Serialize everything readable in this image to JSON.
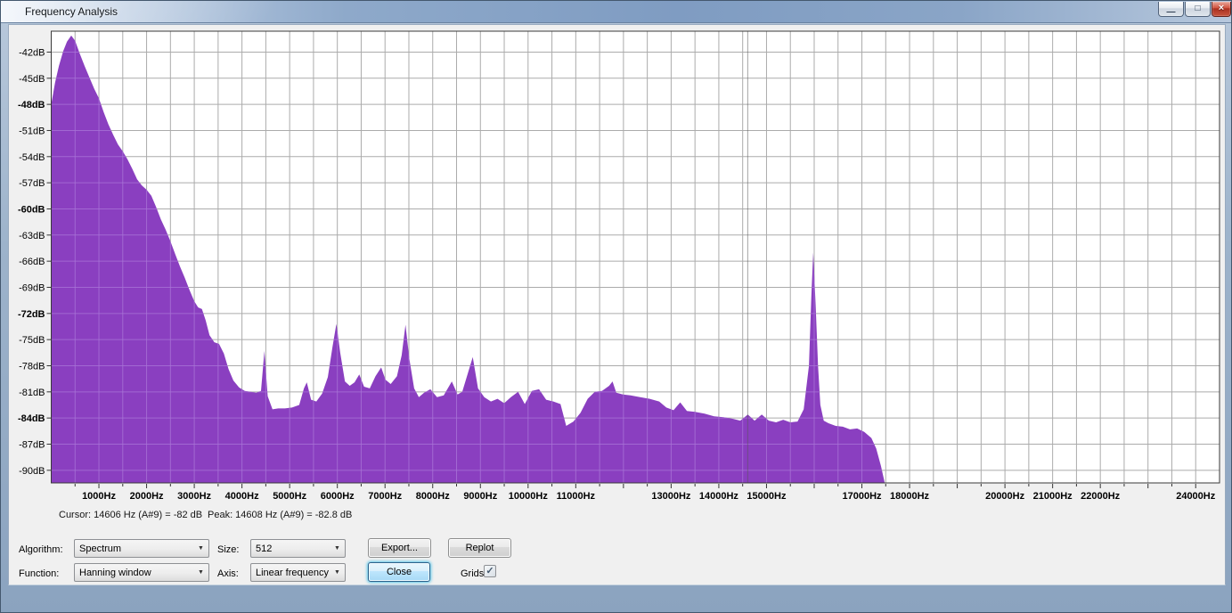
{
  "window": {
    "title": "Frequency Analysis"
  },
  "icons": {
    "minimize": "—",
    "maximize": "□",
    "close": "×",
    "combo_arrow": "▼",
    "check": "✓"
  },
  "status": {
    "cursor": "Cursor: 14606 Hz (A#9) = -82 dB",
    "peak": "Peak: 14608 Hz (A#9) = -82.8 dB"
  },
  "controls": {
    "algorithm_label": "Algorithm:",
    "algorithm_value": "Spectrum",
    "size_label": "Size:",
    "size_value": "512",
    "function_label": "Function:",
    "function_value": "Hanning window",
    "axis_label": "Axis:",
    "axis_value": "Linear frequency",
    "export_label": "Export...",
    "replot_label": "Replot",
    "close_label": "Close",
    "grids_label": "Grids",
    "grids_checked": true
  },
  "chart_data": {
    "type": "area",
    "series_name": "Spectrum (Hanning window, size 512)",
    "xlim": [
      0,
      24500
    ],
    "ylim": [
      -91.45,
      -39.6
    ],
    "grid": true,
    "grid_spacing_hz": 500,
    "grid_spacing_db": 3,
    "cursor_hz": 14606,
    "x_labels": [
      {
        "f": 1000,
        "label": "1000Hz"
      },
      {
        "f": 2000,
        "label": "2000Hz"
      },
      {
        "f": 3000,
        "label": "3000Hz"
      },
      {
        "f": 4000,
        "label": "4000Hz"
      },
      {
        "f": 5000,
        "label": "5000Hz"
      },
      {
        "f": 6000,
        "label": "6000Hz"
      },
      {
        "f": 7000,
        "label": "7000Hz"
      },
      {
        "f": 8000,
        "label": "8000Hz"
      },
      {
        "f": 9000,
        "label": "9000Hz"
      },
      {
        "f": 10000,
        "label": "10000Hz"
      },
      {
        "f": 11000,
        "label": "11000Hz"
      },
      {
        "f": 13000,
        "label": "13000Hz"
      },
      {
        "f": 14000,
        "label": "14000Hz"
      },
      {
        "f": 15000,
        "label": "15000Hz"
      },
      {
        "f": 17000,
        "label": "17000Hz"
      },
      {
        "f": 18000,
        "label": "18000Hz"
      },
      {
        "f": 20000,
        "label": "20000Hz"
      },
      {
        "f": 21000,
        "label": "21000Hz"
      },
      {
        "f": 22000,
        "label": "22000Hz"
      },
      {
        "f": 24000,
        "label": "24000Hz"
      }
    ],
    "y_ticks": [
      {
        "db": -42,
        "label": "-42dB",
        "bold": false
      },
      {
        "db": -45,
        "label": "-45dB",
        "bold": false
      },
      {
        "db": -48,
        "label": "-48dB",
        "bold": true
      },
      {
        "db": -51,
        "label": "-51dB",
        "bold": false
      },
      {
        "db": -54,
        "label": "-54dB",
        "bold": false
      },
      {
        "db": -57,
        "label": "-57dB",
        "bold": false
      },
      {
        "db": -60,
        "label": "-60dB",
        "bold": true
      },
      {
        "db": -63,
        "label": "-63dB",
        "bold": false
      },
      {
        "db": -66,
        "label": "-66dB",
        "bold": false
      },
      {
        "db": -69,
        "label": "-69dB",
        "bold": false
      },
      {
        "db": -72,
        "label": "-72dB",
        "bold": true
      },
      {
        "db": -75,
        "label": "-75dB",
        "bold": false
      },
      {
        "db": -78,
        "label": "-78dB",
        "bold": false
      },
      {
        "db": -81,
        "label": "-81dB",
        "bold": false
      },
      {
        "db": -84,
        "label": "-84dB",
        "bold": true
      },
      {
        "db": -87,
        "label": "-87dB",
        "bold": false
      },
      {
        "db": -90,
        "label": "-90dB",
        "bold": false
      }
    ],
    "series": [
      {
        "name": "Spectrum",
        "points": [
          [
            0,
            -48
          ],
          [
            80,
            -45.5
          ],
          [
            160,
            -43.6
          ],
          [
            250,
            -41.9
          ],
          [
            330,
            -40.8
          ],
          [
            420,
            -40.1
          ],
          [
            500,
            -40.7
          ],
          [
            600,
            -42.2
          ],
          [
            700,
            -43.6
          ],
          [
            800,
            -44.9
          ],
          [
            900,
            -46.2
          ],
          [
            1000,
            -47.3
          ],
          [
            1100,
            -48.9
          ],
          [
            1200,
            -50.3
          ],
          [
            1300,
            -51.5
          ],
          [
            1400,
            -52.6
          ],
          [
            1500,
            -53.4
          ],
          [
            1600,
            -54.3
          ],
          [
            1700,
            -55.4
          ],
          [
            1800,
            -56.6
          ],
          [
            1900,
            -57.3
          ],
          [
            2000,
            -57.8
          ],
          [
            2100,
            -58.5
          ],
          [
            2200,
            -59.8
          ],
          [
            2300,
            -61.2
          ],
          [
            2400,
            -62.4
          ],
          [
            2500,
            -63.7
          ],
          [
            2600,
            -65.2
          ],
          [
            2700,
            -66.6
          ],
          [
            2800,
            -67.9
          ],
          [
            2900,
            -69.3
          ],
          [
            3000,
            -70.6
          ],
          [
            3080,
            -71.3
          ],
          [
            3160,
            -71.5
          ],
          [
            3240,
            -72.8
          ],
          [
            3320,
            -74.5
          ],
          [
            3420,
            -75.3
          ],
          [
            3520,
            -75.5
          ],
          [
            3620,
            -76.6
          ],
          [
            3720,
            -78.4
          ],
          [
            3820,
            -79.7
          ],
          [
            3940,
            -80.5
          ],
          [
            4060,
            -80.9
          ],
          [
            4180,
            -81
          ],
          [
            4300,
            -81.1
          ],
          [
            4400,
            -80.9
          ],
          [
            4470,
            -76.3
          ],
          [
            4540,
            -81.5
          ],
          [
            4640,
            -83
          ],
          [
            4760,
            -82.9
          ],
          [
            4900,
            -82.9
          ],
          [
            5050,
            -82.8
          ],
          [
            5200,
            -82.5
          ],
          [
            5300,
            -80.6
          ],
          [
            5360,
            -79.9
          ],
          [
            5450,
            -81.9
          ],
          [
            5560,
            -82.1
          ],
          [
            5680,
            -81.2
          ],
          [
            5800,
            -79.3
          ],
          [
            5900,
            -75.8
          ],
          [
            5980,
            -73.2
          ],
          [
            6060,
            -76.5
          ],
          [
            6160,
            -79.8
          ],
          [
            6260,
            -80.3
          ],
          [
            6360,
            -79.9
          ],
          [
            6460,
            -79
          ],
          [
            6560,
            -80.4
          ],
          [
            6680,
            -80.6
          ],
          [
            6800,
            -79.2
          ],
          [
            6920,
            -78.2
          ],
          [
            7010,
            -79.6
          ],
          [
            7120,
            -80.1
          ],
          [
            7250,
            -79.2
          ],
          [
            7350,
            -76.8
          ],
          [
            7430,
            -73.3
          ],
          [
            7510,
            -77.2
          ],
          [
            7610,
            -80.6
          ],
          [
            7710,
            -81.6
          ],
          [
            7820,
            -81.1
          ],
          [
            7950,
            -80.7
          ],
          [
            8090,
            -81.6
          ],
          [
            8230,
            -81.4
          ],
          [
            8400,
            -79.8
          ],
          [
            8520,
            -81.3
          ],
          [
            8620,
            -81
          ],
          [
            8740,
            -78.8
          ],
          [
            8840,
            -77
          ],
          [
            8950,
            -80.6
          ],
          [
            9080,
            -81.6
          ],
          [
            9220,
            -82.1
          ],
          [
            9360,
            -81.8
          ],
          [
            9500,
            -82.3
          ],
          [
            9640,
            -81.6
          ],
          [
            9790,
            -81
          ],
          [
            9930,
            -82.4
          ],
          [
            10080,
            -80.9
          ],
          [
            10230,
            -80.7
          ],
          [
            10380,
            -81.9
          ],
          [
            10530,
            -82.1
          ],
          [
            10680,
            -82.4
          ],
          [
            10800,
            -84.9
          ],
          [
            10950,
            -84.4
          ],
          [
            11100,
            -83.4
          ],
          [
            11250,
            -81.8
          ],
          [
            11400,
            -81
          ],
          [
            11550,
            -80.9
          ],
          [
            11700,
            -80.3
          ],
          [
            11770,
            -79.8
          ],
          [
            11850,
            -81.1
          ],
          [
            11990,
            -81.3
          ],
          [
            12150,
            -81.4
          ],
          [
            12350,
            -81.6
          ],
          [
            12550,
            -81.8
          ],
          [
            12750,
            -82.1
          ],
          [
            12900,
            -82.8
          ],
          [
            13050,
            -83.1
          ],
          [
            13190,
            -82.2
          ],
          [
            13330,
            -83.2
          ],
          [
            13500,
            -83.3
          ],
          [
            13700,
            -83.5
          ],
          [
            13900,
            -83.8
          ],
          [
            14100,
            -83.9
          ],
          [
            14300,
            -84.1
          ],
          [
            14450,
            -84.3
          ],
          [
            14608,
            -83.6
          ],
          [
            14750,
            -84.3
          ],
          [
            14900,
            -83.6
          ],
          [
            15050,
            -84.3
          ],
          [
            15200,
            -84.5
          ],
          [
            15350,
            -84.2
          ],
          [
            15500,
            -84.5
          ],
          [
            15650,
            -84.4
          ],
          [
            15780,
            -83
          ],
          [
            15890,
            -78
          ],
          [
            15940,
            -70
          ],
          [
            15980,
            -65
          ],
          [
            16030,
            -71
          ],
          [
            16080,
            -78
          ],
          [
            16130,
            -82.5
          ],
          [
            16200,
            -84.3
          ],
          [
            16300,
            -84.6
          ],
          [
            16450,
            -84.9
          ],
          [
            16600,
            -85
          ],
          [
            16750,
            -85.3
          ],
          [
            16900,
            -85.2
          ],
          [
            17050,
            -85.6
          ],
          [
            17200,
            -86.3
          ],
          [
            17300,
            -87.5
          ],
          [
            17400,
            -89.5
          ],
          [
            17480,
            -91.5
          ],
          [
            24500,
            -92
          ]
        ]
      }
    ],
    "colors": {
      "fill": "#8a3fc0",
      "grid": "#ababab",
      "grid_over_fill": "#a873d6",
      "plot_border": "#3a3a3a",
      "plot_bg": "#ffffff"
    }
  }
}
